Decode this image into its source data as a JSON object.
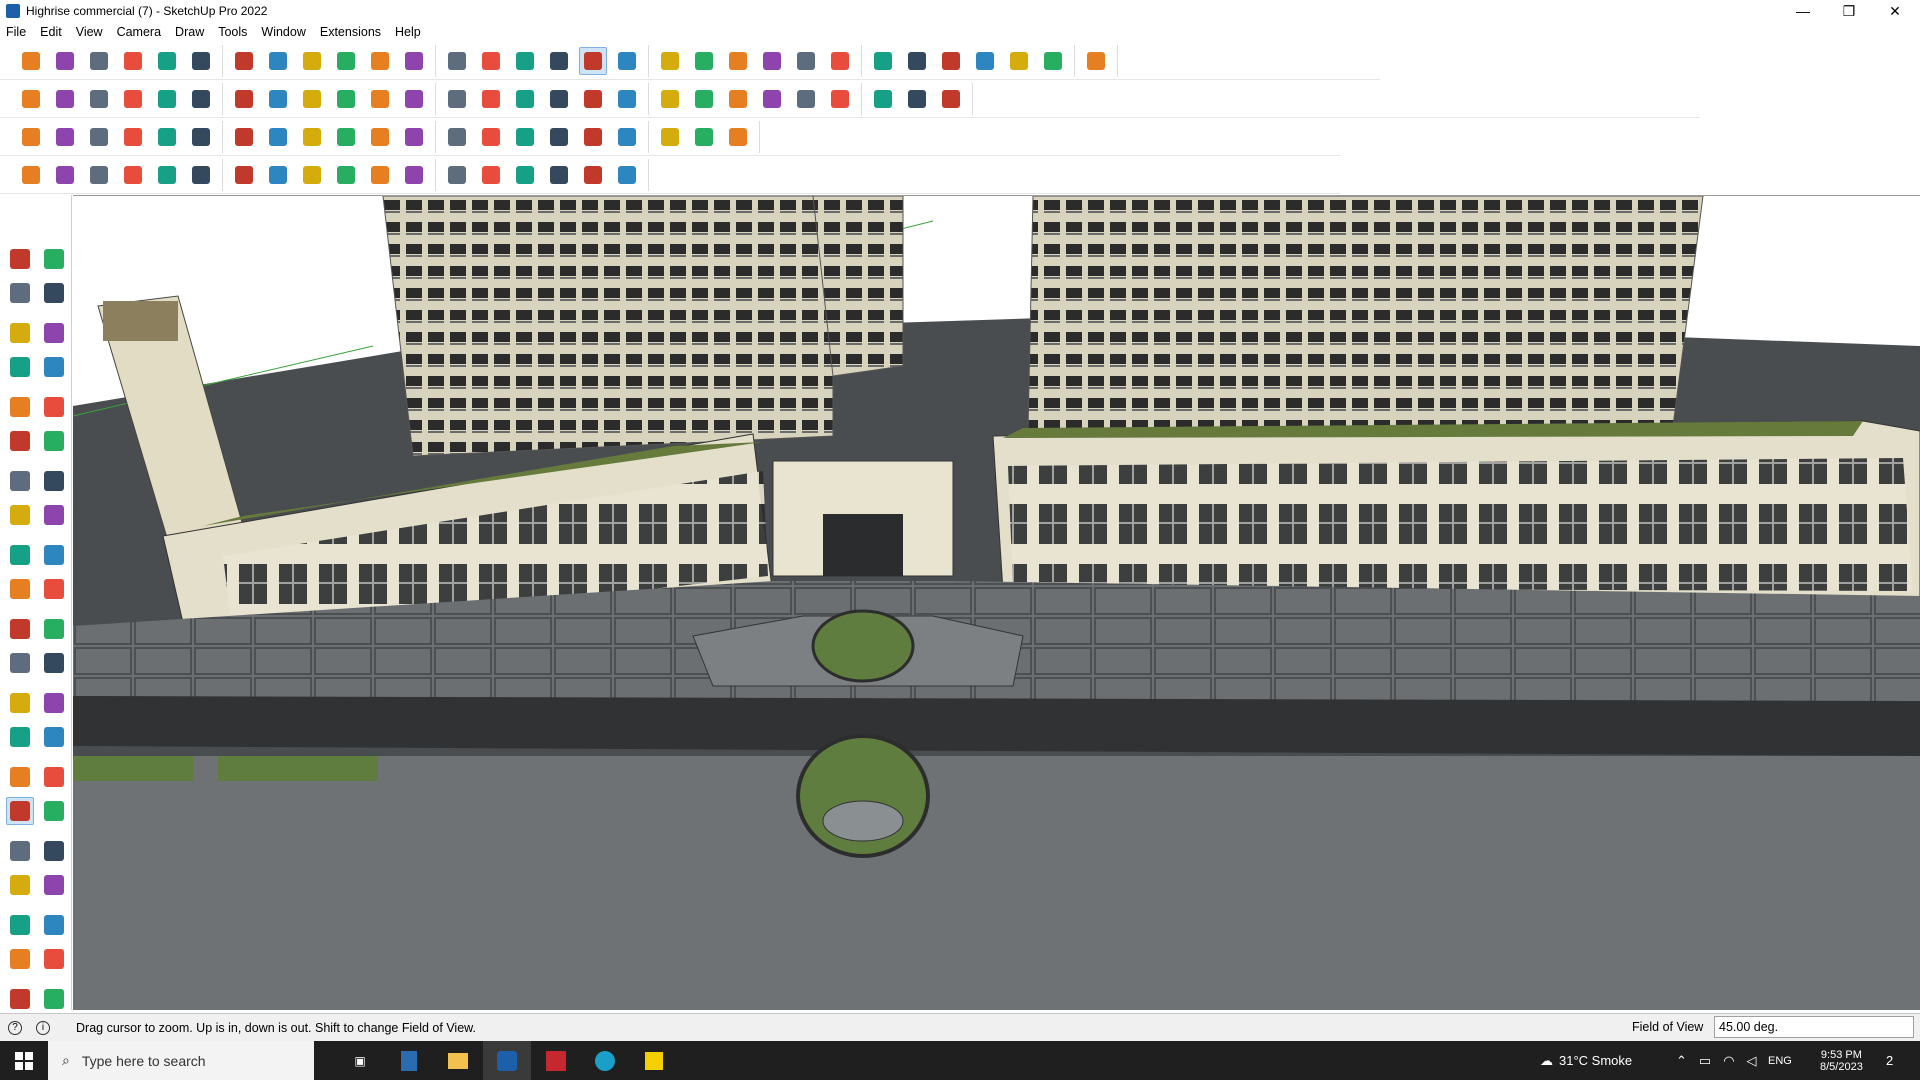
{
  "window": {
    "title": "Highrise commercial (7) - SketchUp Pro 2022",
    "controls": [
      "minimize-icon",
      "restore-icon",
      "close-icon"
    ]
  },
  "menu": [
    "File",
    "Edit",
    "View",
    "Camera",
    "Draw",
    "Tools",
    "Window",
    "Extensions",
    "Help"
  ],
  "toolbars": {
    "row1": [
      "zoom-icon",
      "select-icon",
      "eraser-icon",
      "pencil-icon",
      "lasso-icon",
      "paint-icon",
      "push-pull-icon",
      "follow-me-icon",
      "move-icon",
      "rotate-icon",
      "scale-icon",
      "tape-icon",
      "text-icon",
      "paint-bucket-icon",
      "orbit-icon",
      "pan-icon",
      "zoom-icon",
      "zoom-extents-icon",
      "components-icon",
      "materials-icon",
      "layers-icon",
      "styles-icon",
      "user-icon",
      "warehouse-icon",
      "extension-icon",
      "section-icon",
      "sandbox-icon",
      "solid-icon",
      "undo-icon",
      "redo-icon",
      "dynamic-icon"
    ],
    "row2": [
      "box-icon",
      "iso-icon",
      "top-icon",
      "front-icon",
      "right-icon",
      "back-icon",
      "left-icon",
      "bottom-icon",
      "xray-icon",
      "wireframe-icon",
      "hidden-line-icon",
      "shaded-icon",
      "textured-icon",
      "monochrome-icon",
      "house-icon",
      "shadow-icon",
      "fog-icon",
      "protractor-icon",
      "dimension-icon",
      "axes-icon",
      "3d-text-icon",
      "rectangle-icon",
      "circle-icon",
      "polygon-icon",
      "arc-icon",
      "freehand-icon",
      "offset-icon"
    ],
    "row3": [
      "face-icon",
      "flip-icon",
      "intersect-icon",
      "trim-icon",
      "outer-shell-icon",
      "union-icon",
      "subtract-icon",
      "split-icon",
      "weld-icon",
      "bezier-icon",
      "curve-icon",
      "cross-icon",
      "mirror-icon",
      "align-icon",
      "cone-icon",
      "loop-icon",
      "join-icon",
      "explode-icon",
      "grid-icon",
      "array-icon",
      "cube-icon"
    ],
    "row4": [
      "line-tool-icon",
      "spline-icon",
      "path-icon",
      "cut-icon",
      "gear-icon",
      "shape-icon",
      "bend-icon",
      "loft-icon",
      "sphere-icon",
      "sweep-icon",
      "stair-icon",
      "rail-icon",
      "wall-icon",
      "window-tool-icon",
      "roof-icon",
      "fence-icon",
      "rib-icon",
      "hatch-icon"
    ]
  },
  "tools_palette": [
    "select-icon",
    "orbit-icon",
    "paint-bucket-icon",
    "eraser-icon",
    "component-icon",
    "tape-icon",
    "pencil-icon",
    "freehand-icon",
    "rectangle-icon",
    "rotated-rect-icon",
    "circle-icon",
    "polygon-icon",
    "arc-icon",
    "pie-icon",
    "two-point-arc-icon",
    "three-point-arc-icon",
    "move-icon",
    "push-pull-icon",
    "rotate-icon",
    "follow-me-icon",
    "scale-icon",
    "offset-icon",
    "tape-measure-icon",
    "dimension-icon",
    "protractor-icon",
    "text-icon",
    "axes-icon",
    "3d-text-icon",
    "orbit-icon",
    "pan-icon",
    "zoom-icon",
    "zoom-window-icon",
    "zoom-extents-icon",
    "previous-icon",
    "position-camera-icon",
    "look-around-icon",
    "walk-icon",
    "section-plane-icon",
    "sandbox-icon",
    "smoove-icon",
    "stamp-icon",
    "drape-icon"
  ],
  "status": {
    "hint": "Drag cursor to zoom.  Up is in, down is out. Shift to change Field of View.",
    "fov_label": "Field of View",
    "fov_value": "45.00 deg."
  },
  "taskbar": {
    "search_placeholder": "Type here to search",
    "weather": "31°C  Smoke",
    "lang": "ENG",
    "time": "9:53 PM",
    "date": "8/5/2023",
    "notifications": "2"
  },
  "colors": {
    "toolbar_active": "#cfe3f7",
    "sky": "#ffffff",
    "ground": "#5a5d5f",
    "facade": "#e6e2cf",
    "lawn": "#5f7d3e",
    "taskbar": "#1f1f1f"
  }
}
